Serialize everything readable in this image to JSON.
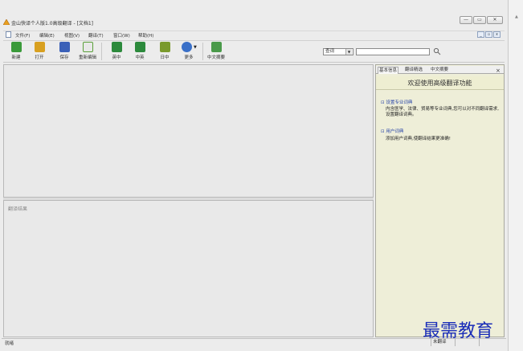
{
  "window": {
    "title": "金山快译个人版1.0高级翻译 - [文档1]",
    "controls": [
      "—",
      "▭",
      "✕"
    ]
  },
  "menu": {
    "items": [
      "文件(F)",
      "编辑(E)",
      "视图(V)",
      "翻译(T)",
      "窗口(W)",
      "帮助(H)"
    ],
    "mdi_controls": [
      "_",
      "▫",
      "x"
    ]
  },
  "toolbar": {
    "buttons": [
      {
        "label": "新建",
        "icon": "new-doc-icon",
        "color": "#3a9a3a"
      },
      {
        "label": "打开",
        "icon": "open-folder-icon",
        "color": "#d8a020"
      },
      {
        "label": "保存",
        "icon": "save-disk-icon",
        "color": "#3a60b8"
      },
      {
        "label": "重新编辑",
        "icon": "re-edit-icon",
        "color": "#5aa03a"
      },
      {
        "label": "英中",
        "icon": "en-zh-translate-icon",
        "color": "#2c8a3c"
      },
      {
        "label": "中英",
        "icon": "zh-en-translate-icon",
        "color": "#2c8a3c"
      },
      {
        "label": "日中",
        "icon": "jp-zh-translate-icon",
        "color": "#7a9a2c"
      },
      {
        "label": "更多",
        "icon": "more-globe-icon",
        "color": "#3a70c8"
      },
      {
        "label": "中文摘要",
        "icon": "summary-icon",
        "color": "#4a9a4a"
      }
    ],
    "dict_select": "查词",
    "search_placeholder": ""
  },
  "result": {
    "label": "翻译结果"
  },
  "side_panel": {
    "tabs": [
      "基本信息",
      "翻译精选",
      "中文摘要"
    ],
    "close": "×",
    "welcome": "欢迎使用高级翻译功能",
    "sections": [
      {
        "heading": "⊡ 设置专业词典",
        "text": "内含医学、法律、贸易等专业词典,您可以对不同翻译需求,设置翻译词典。"
      },
      {
        "heading": "⊡ 用户词典",
        "text": "添加用户词典,使翻译结果更准确!"
      }
    ]
  },
  "status": {
    "left": "就绪",
    "cells": [
      "未翻译",
      "",
      ""
    ]
  },
  "watermark": "最需教育",
  "colors": {
    "panel_bg": "#eeeed8",
    "link": "#2a46a8",
    "watermark": "#1a2db8"
  }
}
